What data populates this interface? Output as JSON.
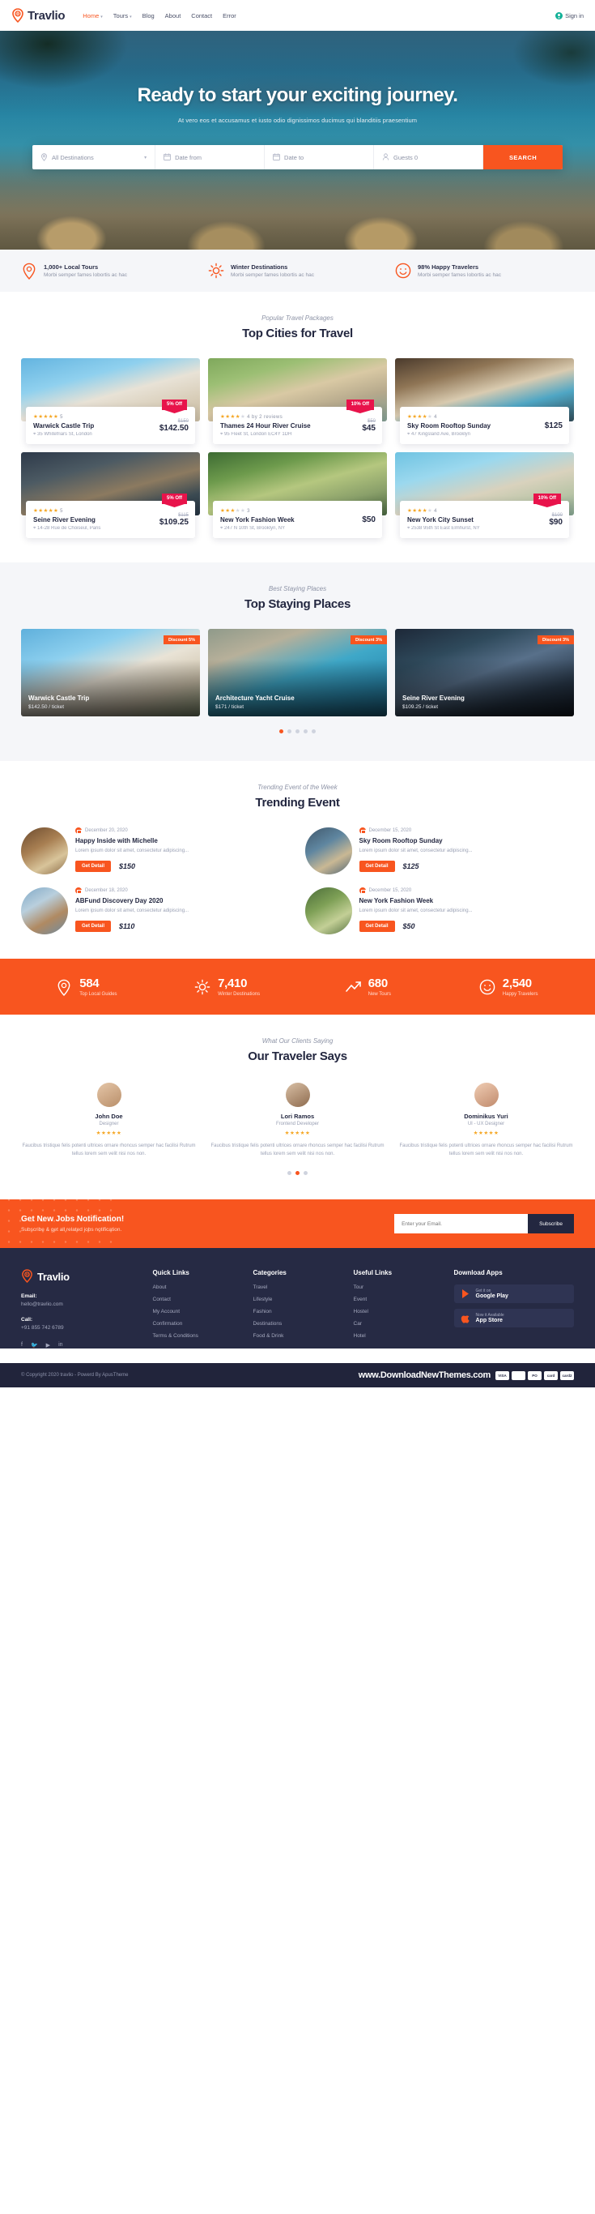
{
  "brand": {
    "name": "Travlio",
    "accent": "#f8551f",
    "dark": "#262a44"
  },
  "header": {
    "nav": [
      {
        "label": "Home",
        "caret": true,
        "active": true
      },
      {
        "label": "Tours",
        "caret": true,
        "active": false
      },
      {
        "label": "Blog",
        "caret": false,
        "active": false
      },
      {
        "label": "About",
        "caret": false,
        "active": false
      },
      {
        "label": "Contact",
        "caret": false,
        "active": false
      },
      {
        "label": "Error",
        "caret": false,
        "active": false
      }
    ],
    "signin": "Sign in"
  },
  "hero": {
    "title": "Ready to start your exciting journey.",
    "subtitle": "At vero eos et accusamus et iusto odio dignissimos ducimus qui blanditiis praesentium",
    "search": {
      "destination": "All Destinations",
      "date_from": "Date from",
      "date_to": "Date to",
      "guests": "Guests 0",
      "button": "SEARCH"
    }
  },
  "features": [
    {
      "icon": "map-pin-icon",
      "title": "1,000+ Local Tours",
      "sub": "Morbi semper fames lobortis ac hac"
    },
    {
      "icon": "sun-icon",
      "title": "Winter Destinations",
      "sub": "Morbi semper fames lobortis ac hac"
    },
    {
      "icon": "smiley-icon",
      "title": "98% Happy Travelers",
      "sub": "Morbi semper fames lobortis ac hac"
    }
  ],
  "cities": {
    "sub": "Popular Travel Packages",
    "title": "Top Cities for Travel",
    "cards": [
      {
        "name": "Warwick Castle Trip",
        "addr": "35 Whitefriars St, London",
        "stars": 5,
        "rating": "5",
        "old": "$150",
        "price": "$142.50",
        "badge": "5% Off",
        "img": "linear-gradient(165deg,#63b4e0 0%,#8fd0ee 32%,#e8e2d6 55%,#d8cdb8 78%,#c4b79d 100%)"
      },
      {
        "name": "Thames 24 Hour River Cruise",
        "addr": "95 Fleet St, London EC4Y 1DH",
        "stars": 4,
        "rating": "4 by 2 reviews",
        "old": "$50",
        "price": "$45",
        "badge": "10% Off",
        "img": "linear-gradient(165deg,#7fa85c 0%,#9cbf74 25%,#d9c9a4 50%,#b6a98c 72%,#7f9a8e 100%)"
      },
      {
        "name": "Sky Room Rooftop Sunday",
        "addr": "47 Kingsland Ave, Brooklyn",
        "stars": 4,
        "rating": "4",
        "old": "",
        "price": "$125",
        "badge": "",
        "img": "linear-gradient(165deg,#4a3a2c 0%,#8f7555 28%,#d9cbb0 52%,#4fa6c4 72%,#2f4a55 100%)"
      },
      {
        "name": "Seine River Evening",
        "addr": "14-28 Rue de Choiseul, Paris",
        "stars": 5,
        "rating": "5",
        "old": "$115",
        "price": "$109.25",
        "badge": "5% Off",
        "img": "linear-gradient(165deg,#2e3a4a 0%,#4c5a63 30%,#8c7a60 58%,#3b4a52 80%,#23303c 100%)"
      },
      {
        "name": "New York Fashion Week",
        "addr": "247 N 10th St, Brooklyn, NY",
        "stars": 3,
        "rating": "3",
        "old": "",
        "price": "$50",
        "badge": "",
        "img": "linear-gradient(165deg,#3d6b33 0%,#6d9a4c 28%,#b5c77f 52%,#8aa06a 76%,#45613c 100%)"
      },
      {
        "name": "New York City Sunset",
        "addr": "2538 95th St East Elmhurst, NY",
        "stars": 4,
        "rating": "4",
        "old": "$100",
        "price": "$90",
        "badge": "10% Off",
        "img": "linear-gradient(165deg,#6fc3e2 0%,#9bd8ee 30%,#d9d2bd 58%,#b8c4a6 80%,#7c9a86 100%)"
      }
    ]
  },
  "staying": {
    "sub": "Best Staying Places",
    "title": "Top Staying Places",
    "cards": [
      {
        "name": "Warwick Castle Trip",
        "price": "$142.50 / ticket",
        "badge": "Discount 5%",
        "img": "linear-gradient(160deg,#5fb0dc 0%,#8ccfee 28%,#e9e3d6 52%,#cfc4ad 76%,#9aa884 100%)"
      },
      {
        "name": "Architecture Yacht Cruise",
        "price": "$171 / ticket",
        "badge": "Discount 3%",
        "img": "linear-gradient(160deg,#8f9a8a 0%,#b7b09a 24%,#3fa8c8 52%,#2d8fb4 74%,#1f6f92 100%)"
      },
      {
        "name": "Seine River Evening",
        "price": "$109.25 / ticket",
        "badge": "Discount 3%",
        "img": "linear-gradient(160deg,#1d2838 0%,#2f4a5c 28%,#58708a 50%,#2a3a4c 76%,#141c28 100%)"
      }
    ],
    "dots": 5,
    "active_dot": 0
  },
  "trending": {
    "sub": "Trending Event of the Week",
    "title": "Trending Event",
    "button": "Get Detail",
    "desc": "Lorem ipsum dolor sit amet, consectetur adipiscing...",
    "items": [
      {
        "date": "December 20, 2020",
        "name": "Happy Inside with Michelle",
        "price": "$150",
        "img": "linear-gradient(150deg,#6b4a2e 0%,#a87f52 40%,#d8c49a 70%,#8a6a46 100%)"
      },
      {
        "date": "December 15, 2020",
        "name": "Sky Room Rooftop Sunday",
        "price": "$125",
        "img": "linear-gradient(150deg,#3f566a 0%,#5f86a0 38%,#c9b894 68%,#4a6274 100%)"
      },
      {
        "date": "December 18, 2020",
        "name": "ABFund Discovery Day 2020",
        "price": "$110",
        "img": "linear-gradient(150deg,#7fa8c6 0%,#b9cfdd 35%,#b08a62 66%,#6d8ca4 100%)"
      },
      {
        "date": "December 15, 2020",
        "name": "New York Fashion Week",
        "price": "$50",
        "img": "linear-gradient(150deg,#4a6b38 0%,#7ea056 38%,#c3cf96 68%,#55713f 100%)"
      }
    ]
  },
  "stats": [
    {
      "icon": "map-pin-icon",
      "number": "584",
      "label": "Top Local Guides"
    },
    {
      "icon": "sun-icon",
      "number": "7,410",
      "label": "Winter Destinations"
    },
    {
      "icon": "trend-icon",
      "number": "680",
      "label": "New Tours"
    },
    {
      "icon": "smiley-icon",
      "number": "2,540",
      "label": "Happy Travelers"
    }
  ],
  "testimonials": {
    "sub": "What Our Clients Saying",
    "title": "Our Traveler Says",
    "quote": "Faucibus tristique felis potenti ultrices ornare rhoncus semper hac facilisi Rutrum tellus lorem sem velit nisi nos non.",
    "items": [
      {
        "name": "John Doe",
        "role": "Designer",
        "stars": 4,
        "img": "linear-gradient(150deg,#e5c6a8,#b98f6a)"
      },
      {
        "name": "Lori Ramos",
        "role": "Frontend Developer",
        "stars": 4,
        "img": "linear-gradient(150deg,#d9c0a6,#8e6b4e)"
      },
      {
        "name": "Dominikus Yuri",
        "role": "UI - UX Designer",
        "stars": 4,
        "img": "linear-gradient(150deg,#f0cdb4,#c08a6c)"
      }
    ],
    "dots": 3,
    "active_dot": 1
  },
  "subscribe": {
    "title": "Get New Jobs Notification!",
    "sub": "Subscribe & get all related jobs notification.",
    "placeholder": "Enter your Email.",
    "button": "Subscribe"
  },
  "footer": {
    "email_label": "Email:",
    "email": "hello@travlio.com",
    "call_label": "Call:",
    "call": "+91 855 742 6789",
    "socials": [
      "facebook-icon",
      "twitter-icon",
      "youtube-icon",
      "linkedin-icon"
    ],
    "columns": [
      {
        "head": "Quick Links",
        "items": [
          "About",
          "Contact",
          "My Account",
          "Confirmation",
          "Terms & Conditions"
        ]
      },
      {
        "head": "Categories",
        "items": [
          "Travel",
          "Lifestyle",
          "Fashion",
          "Destinations",
          "Food & Drink"
        ]
      },
      {
        "head": "Useful Links",
        "items": [
          "Tour",
          "Event",
          "Hostel",
          "Car",
          "Hotel"
        ]
      }
    ],
    "apps_head": "Download Apps",
    "apps": [
      {
        "sub": "Get it on",
        "name": "Google Play"
      },
      {
        "sub": "Now it Available",
        "name": "App Store"
      }
    ],
    "copyright": "© Copyright 2020 travlio - Powerd By ApusTheme",
    "site_url": "www.DownloadNewThemes.com",
    "payments": [
      "VISA",
      "PayPal",
      "PO",
      "card",
      "card2"
    ]
  }
}
